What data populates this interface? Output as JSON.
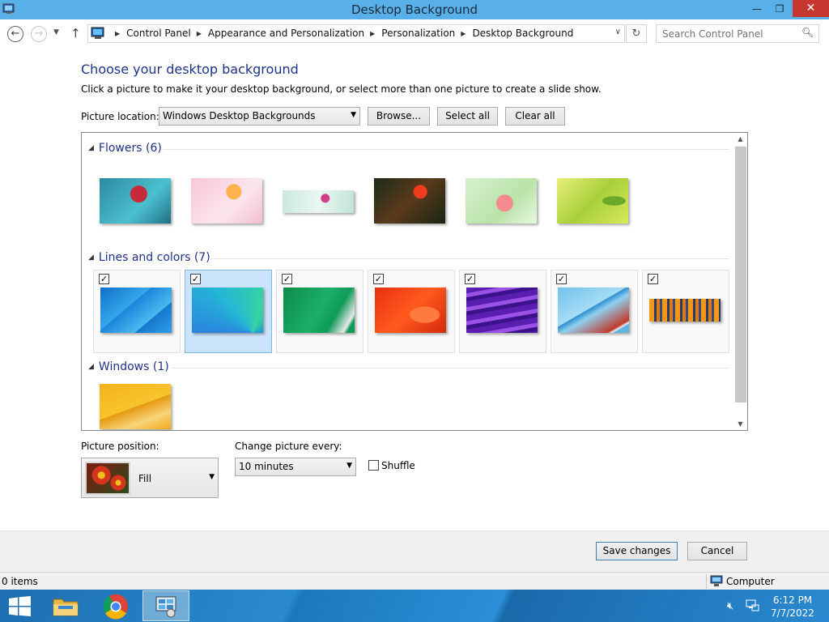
{
  "window": {
    "title": "Desktop Background",
    "minimize": "—",
    "restore": "❐",
    "close": "✕"
  },
  "nav": {
    "back": "←",
    "forward": "→",
    "dropdown": "▼",
    "up": "↑",
    "refresh": "↻",
    "address_dropdown": "∨"
  },
  "breadcrumb": [
    "Control Panel",
    "Appearance and Personalization",
    "Personalization",
    "Desktop Background"
  ],
  "search": {
    "placeholder": "Search Control Panel"
  },
  "heading": "Choose your desktop background",
  "subtitle": "Click a picture to make it your desktop background, or select more than one picture to create a slide show.",
  "picture_location": {
    "label": "Picture location:",
    "value": "Windows Desktop Backgrounds"
  },
  "buttons": {
    "browse": "Browse...",
    "select_all": "Select all",
    "clear_all": "Clear all",
    "save": "Save changes",
    "cancel": "Cancel"
  },
  "groups": {
    "flowers": {
      "label": "Flowers (6)",
      "count": 6
    },
    "lines": {
      "label": "Lines and colors (7)",
      "count": 7,
      "checked": [
        true,
        true,
        true,
        true,
        true,
        true,
        true
      ],
      "selected_index": 1
    },
    "windows": {
      "label": "Windows (1)",
      "count": 1
    }
  },
  "picture_position": {
    "label": "Picture position:",
    "value": "Fill"
  },
  "change_picture": {
    "label": "Change picture every:",
    "value": "10 minutes"
  },
  "shuffle": {
    "label": "Shuffle",
    "checked": false
  },
  "status": {
    "items": "0 items",
    "location": "Computer"
  },
  "clock": {
    "time": "6:12 PM",
    "date": "7/7/2022"
  },
  "check_glyph": "✓",
  "colors": {
    "titlebar": "#59b0e8",
    "heading": "#1e3287",
    "close": "#c7372f",
    "selection": "#cce4fb"
  }
}
